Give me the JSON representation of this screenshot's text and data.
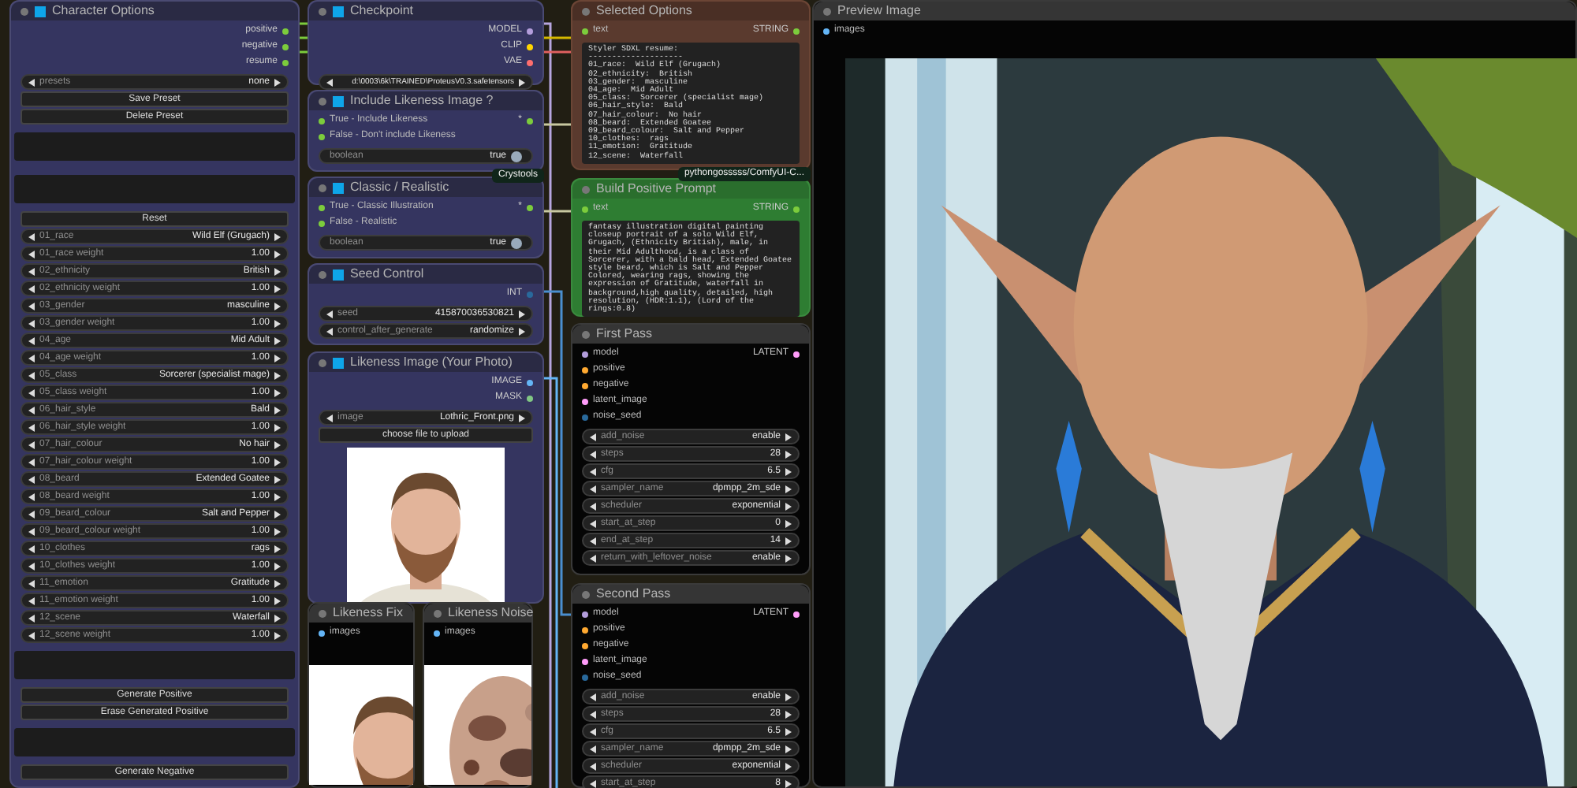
{
  "nodes": [
    {
      "title": "Character Options",
      "outputs": [
        {
          "label": "positive",
          "color": "#7ccc3c"
        },
        {
          "label": "negative",
          "color": "#7ccc3c"
        },
        {
          "label": "resume",
          "color": "#7ccc3c"
        }
      ],
      "widgets": [
        {
          "kind": "combo",
          "label": "presets",
          "value": "none"
        },
        {
          "kind": "button",
          "label": "Save Preset"
        },
        {
          "kind": "button",
          "label": "Delete Preset"
        },
        {
          "kind": "textbox"
        },
        {
          "kind": "textbox"
        },
        {
          "kind": "button",
          "label": "Reset"
        },
        {
          "kind": "combo",
          "label": "01_race",
          "value": "Wild Elf (Grugach)"
        },
        {
          "kind": "combo",
          "label": "01_race weight",
          "value": "1.00"
        },
        {
          "kind": "combo",
          "label": "02_ethnicity",
          "value": "British"
        },
        {
          "kind": "combo",
          "label": "02_ethnicity weight",
          "value": "1.00"
        },
        {
          "kind": "combo",
          "label": "03_gender",
          "value": "masculine"
        },
        {
          "kind": "combo",
          "label": "03_gender weight",
          "value": "1.00"
        },
        {
          "kind": "combo",
          "label": "04_age",
          "value": "Mid Adult"
        },
        {
          "kind": "combo",
          "label": "04_age weight",
          "value": "1.00"
        },
        {
          "kind": "combo",
          "label": "05_class",
          "value": "Sorcerer (specialist mage)"
        },
        {
          "kind": "combo",
          "label": "05_class weight",
          "value": "1.00"
        },
        {
          "kind": "combo",
          "label": "06_hair_style",
          "value": "Bald"
        },
        {
          "kind": "combo",
          "label": "06_hair_style weight",
          "value": "1.00"
        },
        {
          "kind": "combo",
          "label": "07_hair_colour",
          "value": "No hair"
        },
        {
          "kind": "combo",
          "label": "07_hair_colour weight",
          "value": "1.00"
        },
        {
          "kind": "combo",
          "label": "08_beard",
          "value": "Extended Goatee"
        },
        {
          "kind": "combo",
          "label": "08_beard weight",
          "value": "1.00"
        },
        {
          "kind": "combo",
          "label": "09_beard_colour",
          "value": "Salt and Pepper"
        },
        {
          "kind": "combo",
          "label": "09_beard_colour weight",
          "value": "1.00"
        },
        {
          "kind": "combo",
          "label": "10_clothes",
          "value": "rags"
        },
        {
          "kind": "combo",
          "label": "10_clothes weight",
          "value": "1.00"
        },
        {
          "kind": "combo",
          "label": "11_emotion",
          "value": "Gratitude"
        },
        {
          "kind": "combo",
          "label": "11_emotion weight",
          "value": "1.00"
        },
        {
          "kind": "combo",
          "label": "12_scene",
          "value": "Waterfall"
        },
        {
          "kind": "combo",
          "label": "12_scene weight",
          "value": "1.00"
        },
        {
          "kind": "textbox"
        },
        {
          "kind": "button",
          "label": "Generate Positive"
        },
        {
          "kind": "button",
          "label": "Erase Generated Positive"
        },
        {
          "kind": "textbox"
        },
        {
          "kind": "button",
          "label": "Generate Negative"
        }
      ]
    },
    {
      "title": "Checkpoint",
      "outputs": [
        {
          "label": "MODEL",
          "color": "#b39ddb"
        },
        {
          "label": "CLIP",
          "color": "#ffd500"
        },
        {
          "label": "VAE",
          "color": "#ff6e6e"
        }
      ],
      "widgets": [
        {
          "kind": "combo",
          "value": "d:\\0003\\6k\\TRAINED\\ProteusV0.3.safetensors"
        }
      ]
    },
    {
      "title": "Include Likeness Image ?",
      "inputs": [
        {
          "label": "True - Include Likeness",
          "color": "#7ccc3c"
        },
        {
          "label": "False - Don't include Likeness",
          "color": "#7ccc3c"
        }
      ],
      "outputs": [
        {
          "label": "*",
          "color": "#7ccc3c"
        }
      ],
      "widgets": [
        {
          "kind": "toggle",
          "label": "boolean",
          "value": "true",
          "on": true
        }
      ],
      "badge": "Crystools"
    },
    {
      "title": "Classic / Realistic",
      "inputs": [
        {
          "label": "True - Classic Illustration",
          "color": "#7ccc3c"
        },
        {
          "label": "False - Realistic",
          "color": "#7ccc3c"
        }
      ],
      "outputs": [
        {
          "label": "*",
          "color": "#7ccc3c"
        }
      ],
      "widgets": [
        {
          "kind": "toggle",
          "label": "boolean",
          "value": "true",
          "on": true
        }
      ]
    },
    {
      "title": "Seed Control",
      "outputs": [
        {
          "label": "INT",
          "color": "#29699c"
        }
      ],
      "widgets": [
        {
          "kind": "combo",
          "label": "seed",
          "value": "415870036530821"
        },
        {
          "kind": "combo",
          "label": "control_after_generate",
          "value": "randomize"
        }
      ]
    },
    {
      "title": "Likeness Image (Your Photo)",
      "outputs": [
        {
          "label": "IMAGE",
          "color": "#64b5f6"
        },
        {
          "label": "MASK",
          "color": "#81c784"
        }
      ],
      "widgets": [
        {
          "kind": "combo",
          "label": "image",
          "value": "Lothric_Front.png"
        },
        {
          "kind": "button",
          "label": "choose file to upload"
        }
      ],
      "image": {
        "kind": "picture"
      }
    },
    {
      "title": "Likeness Fix",
      "inputs": [
        {
          "label": "images",
          "color": "#64b5f6"
        }
      ],
      "image": {
        "kind": "picture"
      }
    },
    {
      "title": "Likeness Noise",
      "inputs": [
        {
          "label": "images",
          "color": "#64b5f6"
        }
      ],
      "image": {
        "kind": "picture"
      }
    },
    {
      "title": "Selected Options",
      "inputs": [
        {
          "label": "text",
          "color": "#7ccc3c"
        }
      ],
      "outputs": [
        {
          "label": "STRING",
          "color": "#7ccc3c"
        }
      ],
      "text": "Styler SDXL resume:\n--------------------\n01_race:  Wild Elf (Grugach)\n02_ethnicity:  British\n03_gender:  masculine\n04_age:  Mid Adult\n05_class:  Sorcerer (specialist mage)\n06_hair_style:  Bald\n07_hair_colour:  No hair\n08_beard:  Extended Goatee\n09_beard_colour:  Salt and Pepper\n10_clothes:  rags\n11_emotion:  Gratitude\n12_scene:  Waterfall",
      "badge": "pythongosssss/ComfyUI-C..."
    },
    {
      "title": "Build Positive Prompt",
      "inputs": [
        {
          "label": "text",
          "color": "#7ccc3c"
        }
      ],
      "outputs": [
        {
          "label": "STRING",
          "color": "#7ccc3c"
        }
      ],
      "text": "fantasy illustration digital painting closeup portrait of a solo Wild Elf, Grugach, (Ethnicity British), male, in their Mid Adulthood, is a class of Sorcerer, with a bald head, Extended Goatee style beard, which is Salt and Pepper Colored, wearing rags, showing the expression of Gratitude, waterfall in background,high quality, detailed, high resolution, (HDR:1.1), (Lord of the rings:0.8)"
    },
    {
      "title": "First Pass",
      "inputs": [
        {
          "label": "model",
          "color": "#b39ddb"
        },
        {
          "label": "positive",
          "color": "#ffa931"
        },
        {
          "label": "negative",
          "color": "#ffa931"
        },
        {
          "label": "latent_image",
          "color": "#ff9cf9"
        },
        {
          "label": "noise_seed",
          "color": "#29699c"
        }
      ],
      "outputs": [
        {
          "label": "LATENT",
          "color": "#ff9cf9"
        }
      ],
      "widgets": [
        {
          "kind": "combo",
          "label": "add_noise",
          "value": "enable"
        },
        {
          "kind": "combo",
          "label": "steps",
          "value": "28"
        },
        {
          "kind": "combo",
          "label": "cfg",
          "value": "6.5"
        },
        {
          "kind": "combo",
          "label": "sampler_name",
          "value": "dpmpp_2m_sde"
        },
        {
          "kind": "combo",
          "label": "scheduler",
          "value": "exponential"
        },
        {
          "kind": "combo",
          "label": "start_at_step",
          "value": "0"
        },
        {
          "kind": "combo",
          "label": "end_at_step",
          "value": "14"
        },
        {
          "kind": "combo",
          "label": "return_with_leftover_noise",
          "value": "enable"
        }
      ]
    },
    {
      "title": "Second Pass",
      "inputs": [
        {
          "label": "model",
          "color": "#b39ddb"
        },
        {
          "label": "positive",
          "color": "#ffa931"
        },
        {
          "label": "negative",
          "color": "#ffa931"
        },
        {
          "label": "latent_image",
          "color": "#ff9cf9"
        },
        {
          "label": "noise_seed",
          "color": "#29699c"
        }
      ],
      "outputs": [
        {
          "label": "LATENT",
          "color": "#ff9cf9"
        }
      ],
      "widgets": [
        {
          "kind": "combo",
          "label": "add_noise",
          "value": "enable"
        },
        {
          "kind": "combo",
          "label": "steps",
          "value": "28"
        },
        {
          "kind": "combo",
          "label": "cfg",
          "value": "6.5"
        },
        {
          "kind": "combo",
          "label": "sampler_name",
          "value": "dpmpp_2m_sde"
        },
        {
          "kind": "combo",
          "label": "scheduler",
          "value": "exponential"
        },
        {
          "kind": "combo",
          "label": "start_at_step",
          "value": "8"
        }
      ]
    },
    {
      "title": "Preview Image",
      "inputs": [
        {
          "label": "images",
          "color": "#64b5f6"
        }
      ],
      "image": {
        "kind": "picture"
      }
    }
  ]
}
